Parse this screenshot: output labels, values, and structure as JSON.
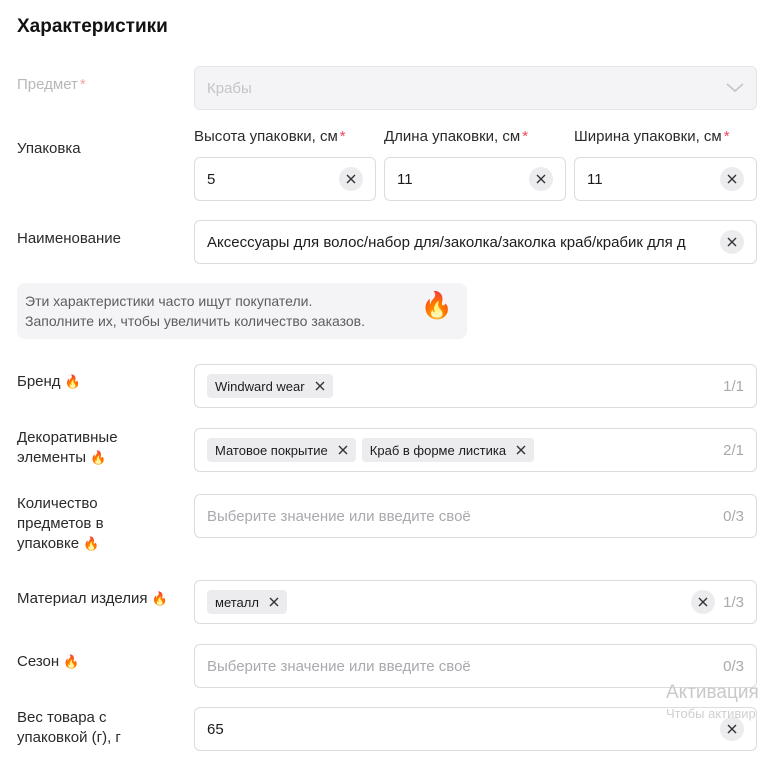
{
  "title": "Характеристики",
  "subject": {
    "label": "Предмет",
    "required_mark": "*",
    "value": "Крабы"
  },
  "packaging": {
    "label": "Упаковка",
    "height": {
      "label": "Высота упаковки, см",
      "required_mark": "*",
      "value": "5"
    },
    "length": {
      "label": "Длина упаковки, см",
      "required_mark": "*",
      "value": "11"
    },
    "width": {
      "label": "Ширина упаковки, см",
      "required_mark": "*",
      "value": "11"
    }
  },
  "name": {
    "label": "Наименование",
    "value": "Аксессуары для волос/набор для/заколка/заколка краб/крабик для д"
  },
  "hint": {
    "line1": "Эти характеристики часто ищут покупатели.",
    "line2": "Заполните их, чтобы увеличить количество заказов.",
    "icon": "fire-icon"
  },
  "brand": {
    "label": "Бренд",
    "chips": [
      "Windward wear"
    ],
    "counter": "1/1"
  },
  "decor": {
    "label_line1": "Декоративные",
    "label_line2": "элементы",
    "chips": [
      "Матовое покрытие",
      "Краб в форме листика"
    ],
    "counter": "2/1"
  },
  "quantity": {
    "label_line1": "Количество",
    "label_line2": "предметов в",
    "label_line3": "упаковке",
    "placeholder": "Выберите значение или введите своё",
    "counter": "0/3"
  },
  "material": {
    "label": "Материал изделия",
    "chips": [
      "металл"
    ],
    "counter": "1/3"
  },
  "season": {
    "label": "Сезон",
    "placeholder": "Выберите значение или введите своё",
    "counter": "0/3"
  },
  "weight": {
    "label_line1": "Вес товара с",
    "label_line2": "упаковкой (г), г",
    "value": "65"
  },
  "watermark": {
    "line1": "Активация",
    "line2": "Чтобы активир"
  },
  "colors": {
    "required": "#f0485a",
    "border": "#dcdce0",
    "chip_bg": "#ececef",
    "hint_bg": "#f4f4f6"
  }
}
